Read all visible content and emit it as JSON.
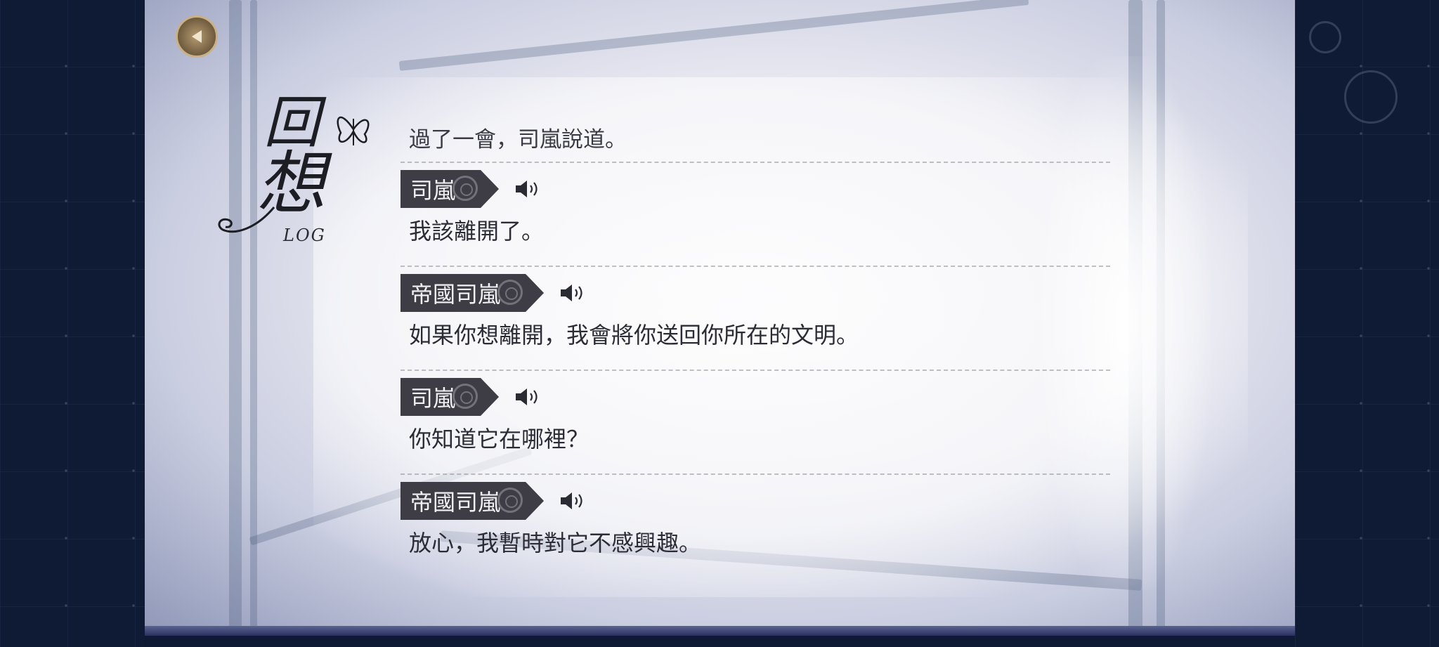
{
  "title": {
    "kanji_top": "回",
    "kanji_bottom": "想",
    "subtitle": "LOG"
  },
  "back_button": {
    "icon": "back-arrow-icon"
  },
  "log": {
    "narration": "過了一會，司嵐說道。",
    "entries": [
      {
        "speaker": "司嵐",
        "text": "我該離開了。",
        "voice_icon": "speaker-icon"
      },
      {
        "speaker": "帝國司嵐",
        "text": "如果你想離開，我會將你送回你所在的文明。",
        "voice_icon": "speaker-icon"
      },
      {
        "speaker": "司嵐",
        "text": "你知道它在哪裡？",
        "voice_icon": "speaker-icon"
      },
      {
        "speaker": "帝國司嵐",
        "text": "放心，我暫時對它不感興趣。",
        "voice_icon": "speaker-icon"
      }
    ]
  },
  "colors": {
    "name_plate": "#3e3c44",
    "name_text": "#f2f2f4",
    "dialogue_text": "#2c2c36",
    "side_background": "#0f1b35"
  }
}
